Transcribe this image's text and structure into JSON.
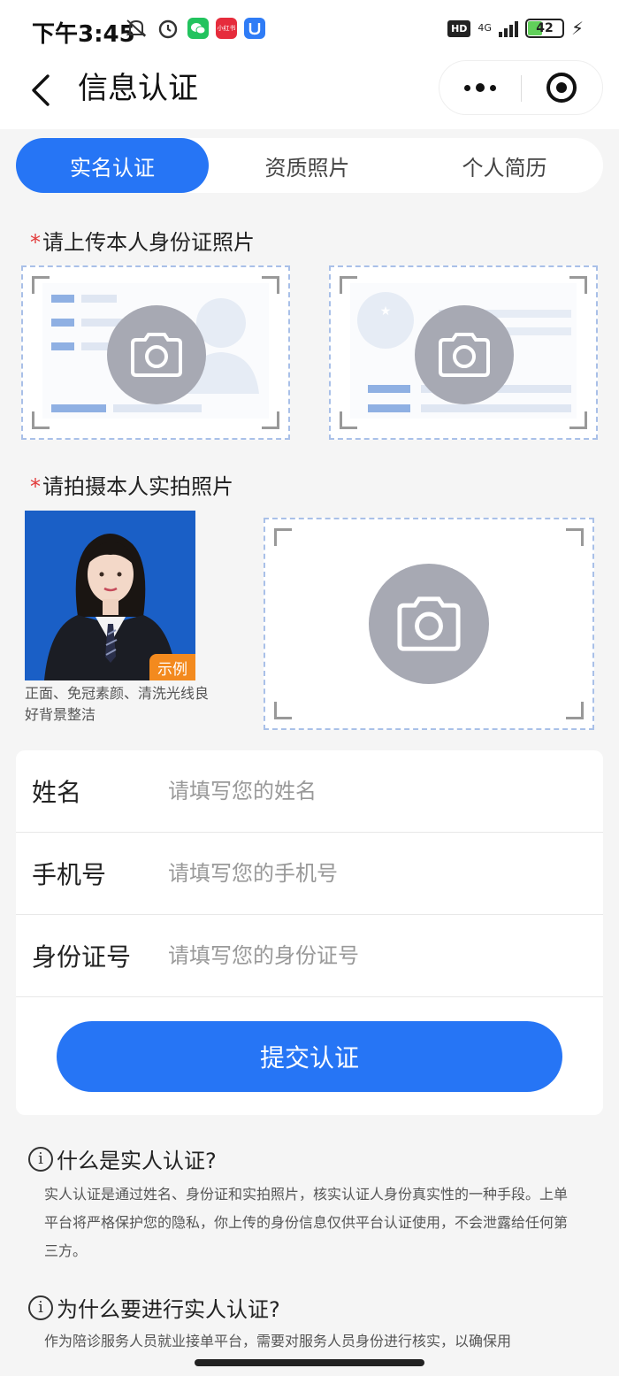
{
  "status_bar": {
    "time": "下午3:45",
    "left_icons": [
      "mute-icon",
      "alarm-icon",
      "wechat-icon",
      "xiaohongshu-icon",
      "app-blue-icon"
    ],
    "red_app_label": "小红书",
    "hd": "HD",
    "network": "4G",
    "battery": "42",
    "battery_level": 0.42
  },
  "nav": {
    "title": "信息认证",
    "back_icon": "chevron-left-icon",
    "more_icon": "more-dots-icon",
    "close_icon": "target-circle-icon"
  },
  "tabs": [
    {
      "label": "实名认证",
      "active": true
    },
    {
      "label": "资质照片",
      "active": false
    },
    {
      "label": "个人简历",
      "active": false
    }
  ],
  "id_section": {
    "required_mark": "*",
    "label": "请上传本人身份证照片"
  },
  "photo_section": {
    "required_mark": "*",
    "label": "请拍摄本人实拍照片",
    "example_tag": "示例",
    "example_note": "正面、免冠素颜、清洗光线良好背景整洁"
  },
  "form": {
    "fields": [
      {
        "label": "姓名",
        "placeholder": "请填写您的姓名",
        "value": ""
      },
      {
        "label": "手机号",
        "placeholder": "请填写您的手机号",
        "value": ""
      },
      {
        "label": "身份证号",
        "placeholder": "请填写您的身份证号",
        "value": ""
      }
    ],
    "submit_label": "提交认证"
  },
  "faq": [
    {
      "title": "什么是实人认证?",
      "body": "实人认证是通过姓名、身份证和实拍照片，核实认证人身份真实性的一种手段。上单平台将严格保护您的隐私，你上传的身份信息仅供平台认证使用，不会泄露给任何第三方。"
    },
    {
      "title": "为什么要进行实人认证?",
      "body": "作为陪诊服务人员就业接单平台，需要对服务人员身份进行核实，以确保用"
    }
  ],
  "colors": {
    "accent": "#2675f5",
    "required": "#e23a3a",
    "example_tag": "#f38a1e"
  }
}
